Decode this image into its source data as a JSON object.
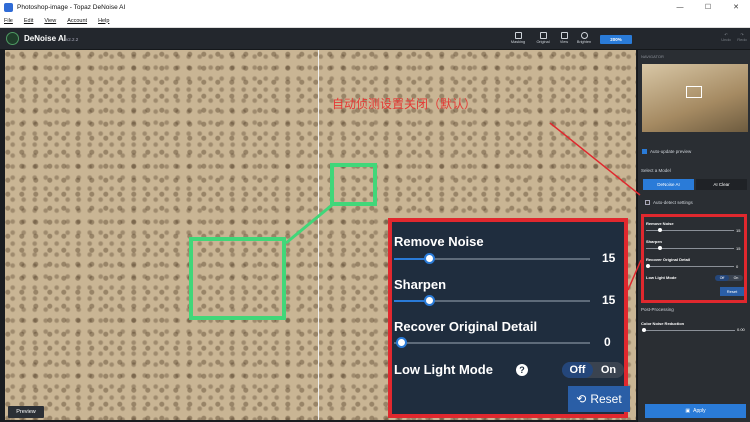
{
  "window": {
    "title": "Photoshop-image - Topaz DeNoise AI"
  },
  "menu": [
    "File",
    "Edit",
    "View",
    "Account",
    "Help"
  ],
  "toolbar": {
    "brand": "DeNoise AI",
    "version": "v2.2.2",
    "buttons": [
      "Masking",
      "Original",
      "View",
      "Brighten"
    ],
    "zoom": "200%",
    "undo": "Undo",
    "redo": "Redo"
  },
  "canvas": {
    "preview_label": "Preview"
  },
  "panel": {
    "navigator": "NAVIGATOR",
    "auto_update": "Auto-update preview",
    "select_model": "Select a Model",
    "models": [
      "DeNoise AI",
      "AI Clear"
    ],
    "auto_detect": "Auto-detect settings",
    "remove_noise": {
      "label": "Remove Noise",
      "value": "15"
    },
    "sharpen": {
      "label": "Sharpen",
      "value": "15"
    },
    "recover": {
      "label": "Recover Original Detail",
      "value": "0"
    },
    "low_light": {
      "label": "Low Light Mode",
      "off": "Off",
      "on": "On"
    },
    "reset": "Reset",
    "post_processing": "Post-Processing",
    "color_noise": {
      "label": "Color Noise Reduction",
      "value": "0.00"
    },
    "apply": "Apply"
  },
  "annotation": {
    "note": "自动侦测设置关闭（默认）"
  },
  "zoom_panel": {
    "remove_noise": {
      "label": "Remove Noise",
      "value": "15"
    },
    "sharpen": {
      "label": "Sharpen",
      "value": "15"
    },
    "recover": {
      "label": "Recover Original Detail",
      "value": "0"
    },
    "low_light": {
      "label": "Low Light Mode",
      "off": "Off",
      "on": "On"
    },
    "reset": "Reset"
  },
  "colors": {
    "accent": "#2a7bd8",
    "annotation_red": "#e0282e",
    "annotation_green": "#41d779"
  }
}
